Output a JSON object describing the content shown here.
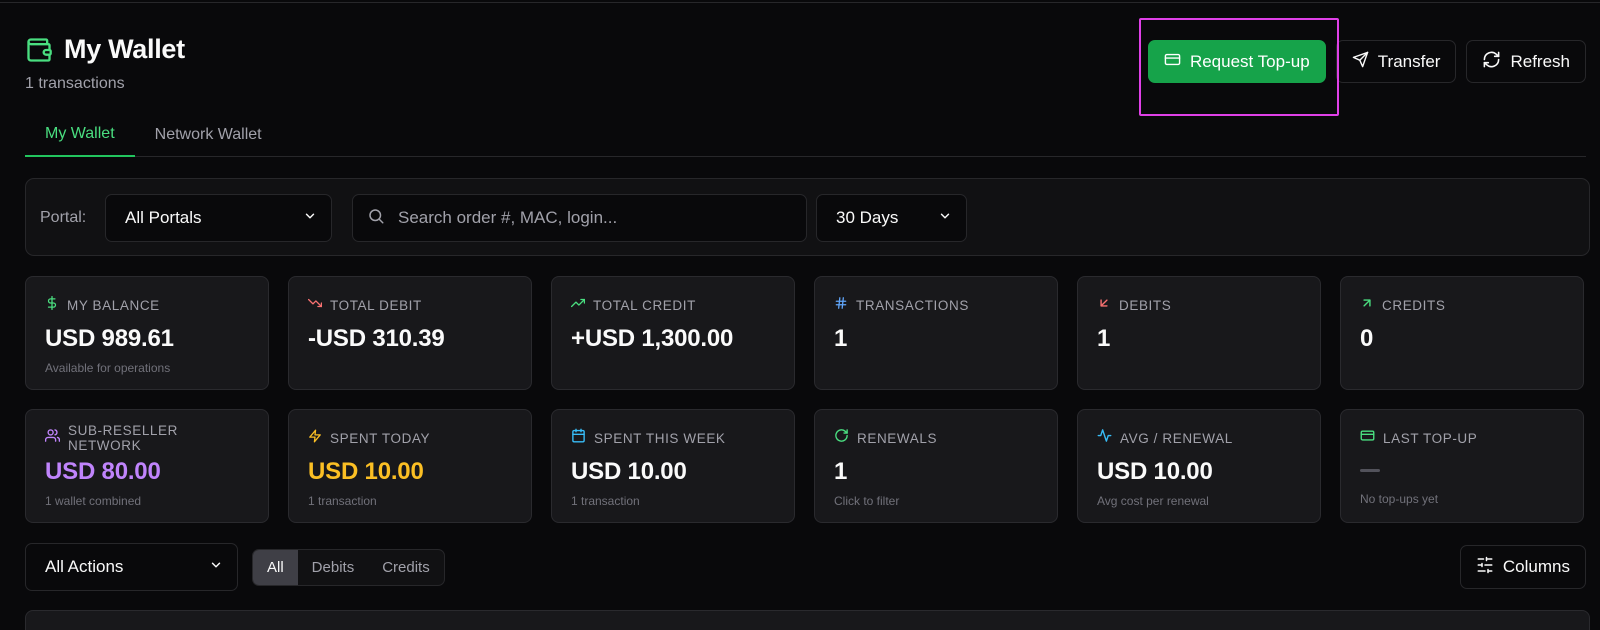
{
  "header": {
    "title": "My Wallet",
    "subtitle": "1 transactions"
  },
  "actions": {
    "request_topup": "Request Top-up",
    "transfer": "Transfer",
    "refresh": "Refresh"
  },
  "tabs": [
    {
      "label": "My Wallet",
      "active": true
    },
    {
      "label": "Network Wallet",
      "active": false
    }
  ],
  "filters": {
    "portal_label": "Portal:",
    "portal_value": "All Portals",
    "search_placeholder": "Search order #, MAC, login...",
    "period_value": "30 Days"
  },
  "cards": [
    {
      "label": "MY BALANCE",
      "icon": "dollar-icon",
      "value": "USD 989.61",
      "sub": "Available for operations",
      "icon_color": "#4ade80"
    },
    {
      "label": "TOTAL DEBIT",
      "icon": "trending-down-icon",
      "value": "-USD 310.39",
      "sub": "",
      "icon_color": "#f87171"
    },
    {
      "label": "TOTAL CREDIT",
      "icon": "trending-up-icon",
      "value": "+USD 1,300.00",
      "sub": "",
      "icon_color": "#4ade80"
    },
    {
      "label": "TRANSACTIONS",
      "icon": "hash-icon",
      "value": "1",
      "sub": "",
      "icon_color": "#60a5fa"
    },
    {
      "label": "DEBITS",
      "icon": "arrow-down-left-icon",
      "value": "1",
      "sub": "",
      "icon_color": "#f87171"
    },
    {
      "label": "CREDITS",
      "icon": "arrow-up-right-icon",
      "value": "0",
      "sub": "",
      "icon_color": "#4ade80"
    },
    {
      "label": "SUB-RESELLER NETWORK",
      "icon": "users-icon",
      "value": "USD 80.00",
      "sub": "1 wallet combined",
      "icon_color": "#c084fc",
      "value_color": "#c084fc"
    },
    {
      "label": "SPENT TODAY",
      "icon": "zap-icon",
      "value": "USD 10.00",
      "sub": "1 transaction",
      "icon_color": "#fbbf24",
      "value_color": "#fbbf24"
    },
    {
      "label": "SPENT THIS WEEK",
      "icon": "calendar-icon",
      "value": "USD 10.00",
      "sub": "1 transaction",
      "icon_color": "#38bdf8"
    },
    {
      "label": "RENEWALS",
      "icon": "refresh-icon",
      "value": "1",
      "sub": "Click to filter",
      "icon_color": "#4ade80"
    },
    {
      "label": "AVG / RENEWAL",
      "icon": "activity-icon",
      "value": "USD 10.00",
      "sub": "Avg cost per renewal",
      "icon_color": "#38bdf8"
    },
    {
      "label": "LAST TOP-UP",
      "icon": "credit-card-icon",
      "value": "",
      "sub": "No top-ups yet",
      "icon_color": "#4ade80"
    }
  ],
  "bottom": {
    "actions_filter": "All Actions",
    "segments": [
      "All",
      "Debits",
      "Credits"
    ],
    "columns_label": "Columns"
  },
  "colors": {
    "accent": "#16a34a",
    "highlight": "#e040e8",
    "background": "#09090b"
  }
}
